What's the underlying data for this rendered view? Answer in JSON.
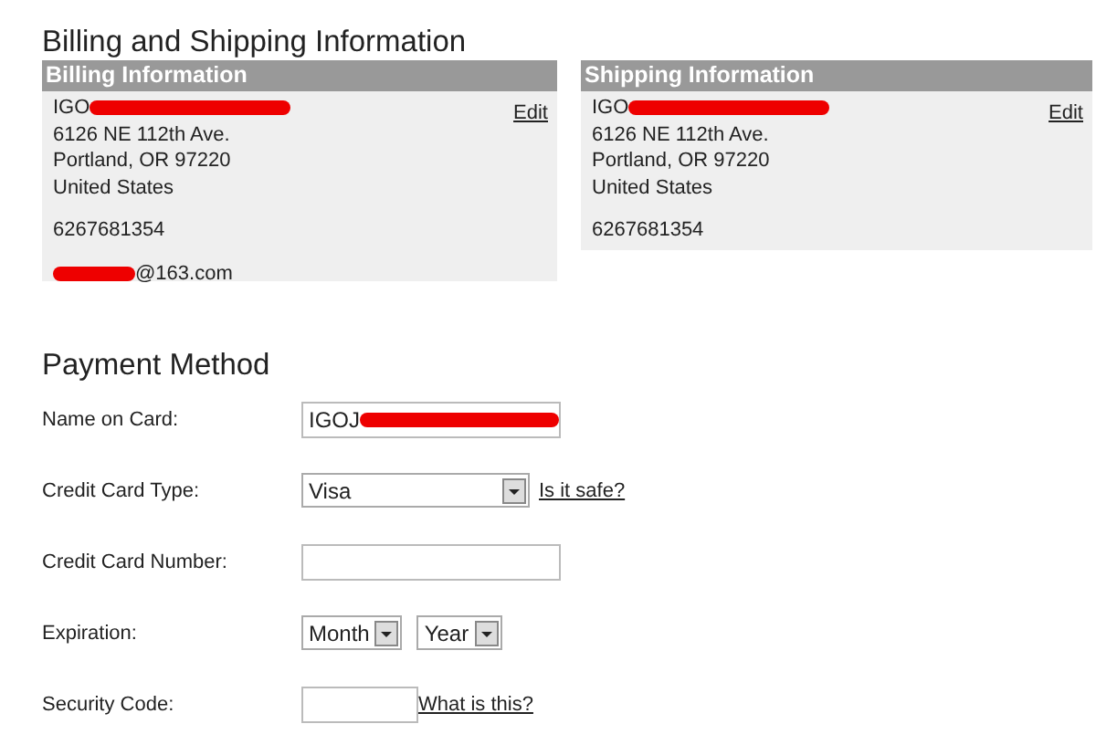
{
  "title": "Billing and Shipping Information",
  "panels": [
    {
      "header": "Billing Information",
      "name": "IGO",
      "name_redacted": true,
      "lines": [
        "6126 NE 112th Ave.",
        "Portland, OR 97220",
        "United States"
      ],
      "phone": "6267681354",
      "email": "@163.com",
      "email_redacted": true,
      "edit": "Edit"
    },
    {
      "header": "Shipping Information",
      "name": "IGO",
      "name_redacted": true,
      "lines": [
        "6126 NE 112th Ave.",
        "Portland, OR 97220",
        "United States"
      ],
      "phone": "6267681354",
      "edit": "Edit"
    }
  ],
  "payment": {
    "title": "Payment Method",
    "rows": [
      {
        "kind": "text",
        "label": "Name on Card:",
        "value": "IGOJ",
        "redacted": true
      },
      {
        "kind": "select",
        "label": "Credit Card Type:",
        "value": "Visa",
        "link": "Is it safe?"
      },
      {
        "kind": "text",
        "label": "Credit Card Number:",
        "value": ""
      },
      {
        "kind": "selects",
        "label": "Expiration:",
        "values": [
          "Month",
          "Year"
        ]
      },
      {
        "kind": "code",
        "label": "Security Code:",
        "value": "",
        "link": "What is this?"
      }
    ]
  }
}
